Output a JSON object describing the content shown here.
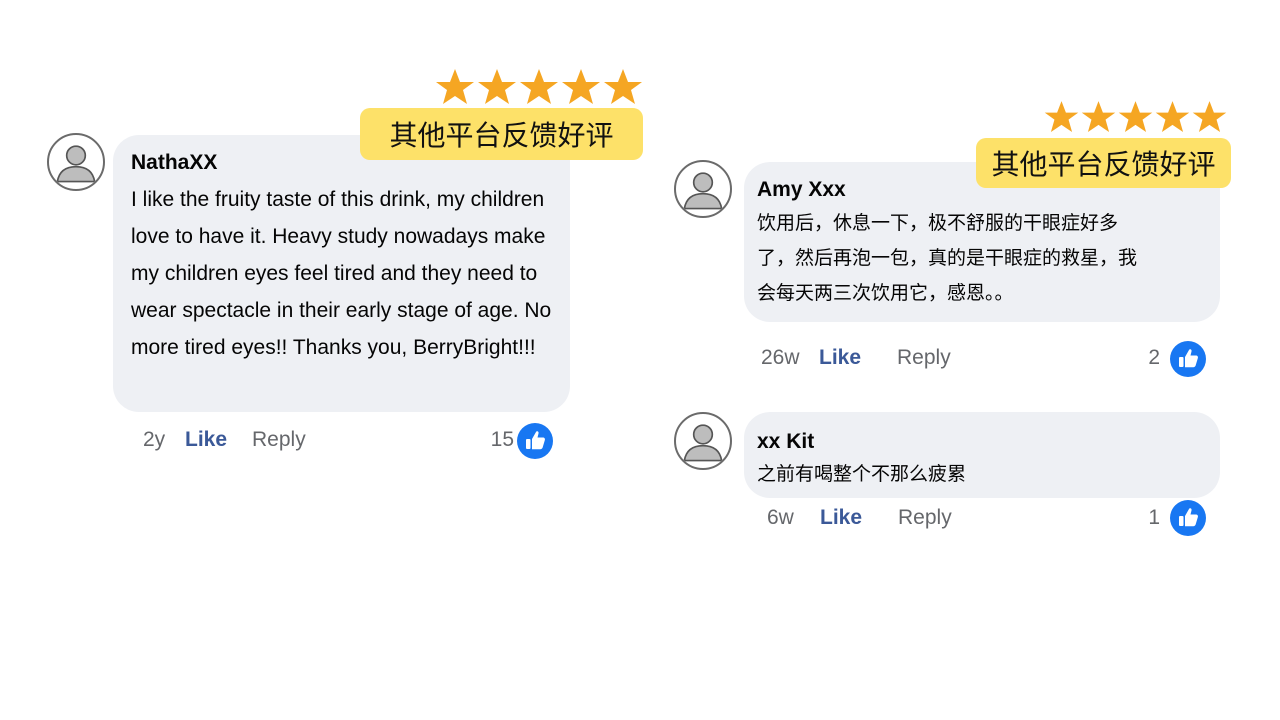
{
  "comments": [
    {
      "author": "NathaXX",
      "text": "I like the fruity taste of this drink, my children love to have it. Heavy study nowadays make my children eyes feel tired and they need to wear spectacle in their early stage of age. No more tired eyes!! Thanks you, BerryBright!!!",
      "time": "2y",
      "like_label": "Like",
      "reply_label": "Reply",
      "like_count": "15",
      "badge": "其他平台反馈好评",
      "stars": 5
    },
    {
      "author": "Amy Xxx",
      "text": "饮用后，休息一下，极不舒服的干眼症好多\n了，然后再泡一包，真的是干眼症的救星，我\n会每天两三次饮用它，感恩。。",
      "time": "26w",
      "like_label": "Like",
      "reply_label": "Reply",
      "like_count": "2",
      "badge": "其他平台反馈好评",
      "stars": 5
    },
    {
      "author": "xx Kit",
      "text": "之前有喝整个不那么疲累",
      "time": "6w",
      "like_label": "Like",
      "reply_label": "Reply",
      "like_count": "1"
    }
  ],
  "colors": {
    "bubble": "#eef0f4",
    "like_blue": "#1877f2",
    "like_text": "#3b5998",
    "badge_yellow": "#fde169",
    "star_orange": "#f5a623",
    "meta_gray": "#65676b"
  },
  "icons": {
    "avatar": "default-user-avatar-icon",
    "like_badge": "thumbs-up-icon",
    "rating": "star-icon"
  }
}
